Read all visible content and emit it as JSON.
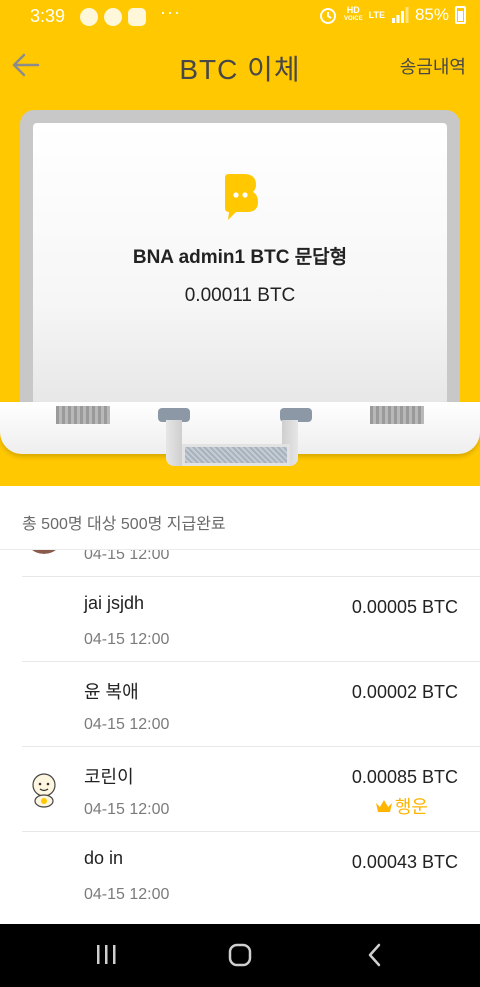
{
  "status_bar": {
    "time": "3:39",
    "dots": "···",
    "network_hd": "HD",
    "network_voice": "VOICE",
    "network_lte": "LTE",
    "battery": "85%"
  },
  "header": {
    "title": "BTC 이체",
    "history_label": "송금내역"
  },
  "card": {
    "name": "BNA admin1  BTC  문답형",
    "amount": "0.00011  BTC"
  },
  "summary": "총 500명 대상 500명 지급완료",
  "recipients": [
    {
      "name": "",
      "date": "04-15 12:00",
      "amount": "",
      "tag": "",
      "avatar": "photo"
    },
    {
      "name": "jai jsjdh",
      "date": "04-15 12:00",
      "amount": "0.00005 BTC",
      "tag": ""
    },
    {
      "name": "윤 복애",
      "date": "04-15 12:00",
      "amount": "0.00002 BTC",
      "tag": ""
    },
    {
      "name": "코린이",
      "date": "04-15 12:00",
      "amount": "0.00085 BTC",
      "tag": "행운",
      "avatar": "character"
    },
    {
      "name": "do in",
      "date": "04-15 12:00",
      "amount": "0.00043 BTC",
      "tag": ""
    }
  ],
  "colors": {
    "brand_yellow": "#ffc800",
    "lucky_gold": "#ffb400"
  },
  "icons": {
    "back": "arrow-left-icon",
    "logo": "bna-chat-logo-icon",
    "crown": "crown-icon",
    "nav_recent": "recent-apps-icon",
    "nav_home": "home-icon",
    "nav_back": "chevron-left-icon"
  }
}
